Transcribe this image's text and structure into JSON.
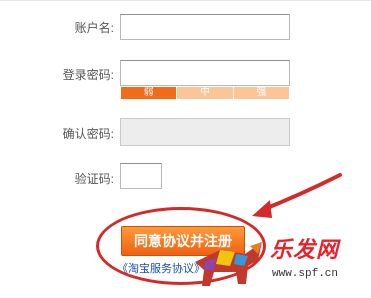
{
  "form": {
    "username_label": "账户名:",
    "password_label": "登录密码:",
    "confirm_label": "确认密码:",
    "captcha_label": "验证码:",
    "strength": {
      "weak": "弱",
      "medium": "中",
      "strong": "强"
    }
  },
  "actions": {
    "agree_label": "同意协议并注册",
    "service_link": "《淘宝服务协议》"
  },
  "watermark": {
    "brand_text": "乐发网",
    "url": "www.spf.cn"
  },
  "colors": {
    "accent": "#f06c1a",
    "highlight": "#d42a2a",
    "link": "#1a4fa3"
  }
}
